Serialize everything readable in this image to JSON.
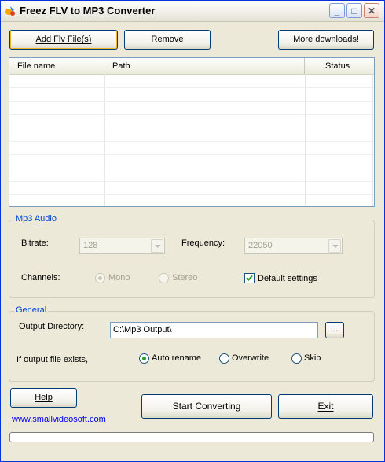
{
  "window": {
    "title": "Freez FLV to MP3 Converter"
  },
  "toolbar": {
    "add_label": "Add Flv File(s)",
    "remove_label": "Remove",
    "more_label": "More downloads!"
  },
  "file_list": {
    "columns": [
      "File name",
      "Path",
      "Status"
    ],
    "rows": []
  },
  "mp3_audio": {
    "group_label": "Mp3 Audio",
    "bitrate_label": "Bitrate:",
    "bitrate_value": "128",
    "frequency_label": "Frequency:",
    "frequency_value": "22050",
    "channels_label": "Channels:",
    "mono_label": "Mono",
    "stereo_label": "Stereo",
    "channel_selected": "Mono",
    "default_settings_label": "Default settings",
    "default_settings_checked": true
  },
  "general": {
    "group_label": "General",
    "output_dir_label": "Output Directory:",
    "output_dir_value": "C:\\Mp3 Output\\",
    "browse_label": "...",
    "exists_label": "If output file exists,",
    "auto_rename_label": "Auto rename",
    "overwrite_label": "Overwrite",
    "skip_label": "Skip",
    "exists_selected": "Auto rename"
  },
  "footer": {
    "help_label": "Help",
    "website_link": "www.smallvideosoft.com",
    "start_label": "Start Converting",
    "exit_label": "Exit",
    "progress": 0
  },
  "colors": {
    "face": "#ECE9D8",
    "group_text": "#0046D5",
    "link": "#0000EE"
  },
  "icons": [
    "app-icon",
    "minimize-icon",
    "maximize-icon",
    "close-icon",
    "checkmark-icon"
  ]
}
